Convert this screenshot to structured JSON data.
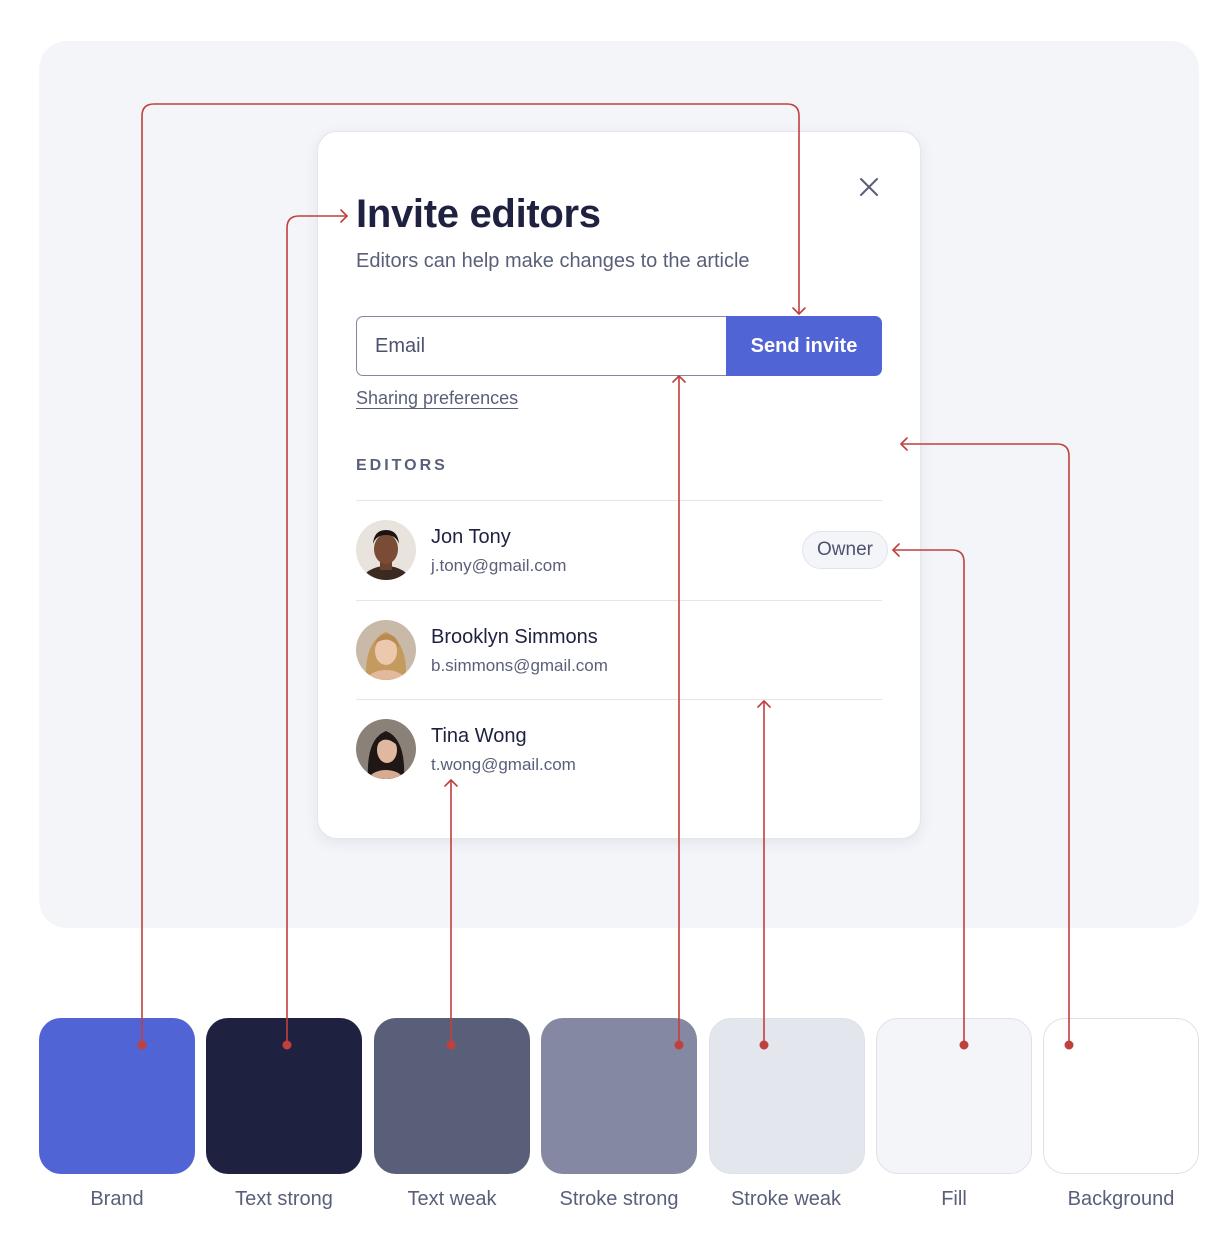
{
  "modal": {
    "title": "Invite editors",
    "subtitle": "Editors can help make changes to the article",
    "email_placeholder": "Email",
    "send_label": "Send invite",
    "sharing_link": "Sharing preferences",
    "section_label": "EDITORS",
    "editors": [
      {
        "name": "Jon Tony",
        "email": "j.tony@gmail.com",
        "badge": "Owner"
      },
      {
        "name": "Brooklyn Simmons",
        "email": "b.simmons@gmail.com"
      },
      {
        "name": "Tina Wong",
        "email": "t.wong@gmail.com"
      }
    ]
  },
  "palette": [
    {
      "label": "Brand",
      "color": "#5164d6"
    },
    {
      "label": "Text strong",
      "color": "#1f2140"
    },
    {
      "label": "Text weak",
      "color": "#5a5f79"
    },
    {
      "label": "Stroke strong",
      "color": "#8488a2"
    },
    {
      "label": "Stroke weak",
      "color": "#e4e6ee"
    },
    {
      "label": "Fill",
      "color": "#f4f5f9"
    },
    {
      "label": "Background",
      "color": "#ffffff"
    }
  ],
  "annotation_color": "#c0403d",
  "icons": {
    "close": "close-icon"
  }
}
